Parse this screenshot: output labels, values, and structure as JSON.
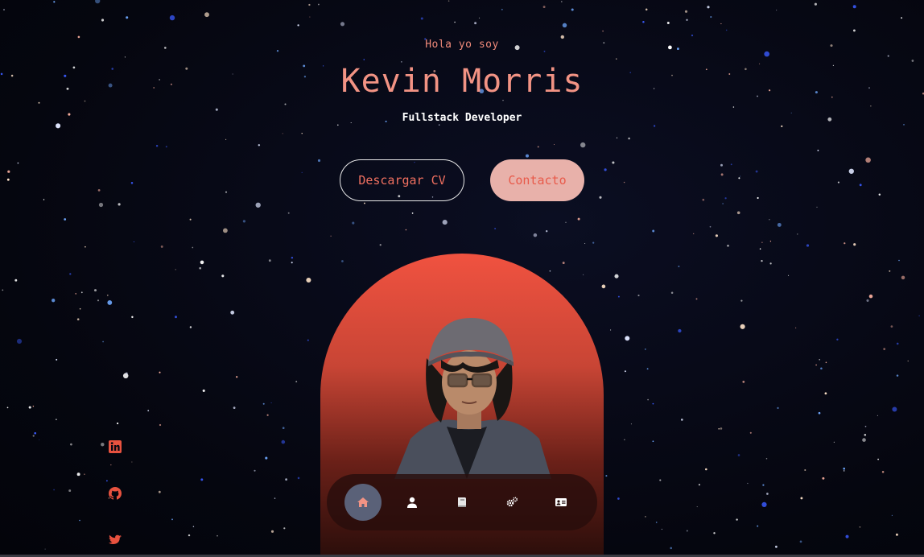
{
  "hero": {
    "greeting": "Hola yo soy",
    "name": "Kevin Morris",
    "role": "Fullstack Developer"
  },
  "buttons": {
    "download_cv": "Descargar CV",
    "contact": "Contacto"
  },
  "socials": [
    {
      "icon": "linkedin-icon"
    },
    {
      "icon": "github-icon"
    },
    {
      "icon": "twitter-icon"
    }
  ],
  "nav": [
    {
      "icon": "home-icon",
      "active": true
    },
    {
      "icon": "user-icon",
      "active": false
    },
    {
      "icon": "book-icon",
      "active": false
    },
    {
      "icon": "gears-icon",
      "active": false
    },
    {
      "icon": "contact-card-icon",
      "active": false
    }
  ],
  "colors": {
    "accent": "#f29384",
    "accent_strong": "#f05240",
    "button_solid_bg": "#e8b1aa",
    "background": "#060812",
    "nav_active": "#5a6178"
  }
}
